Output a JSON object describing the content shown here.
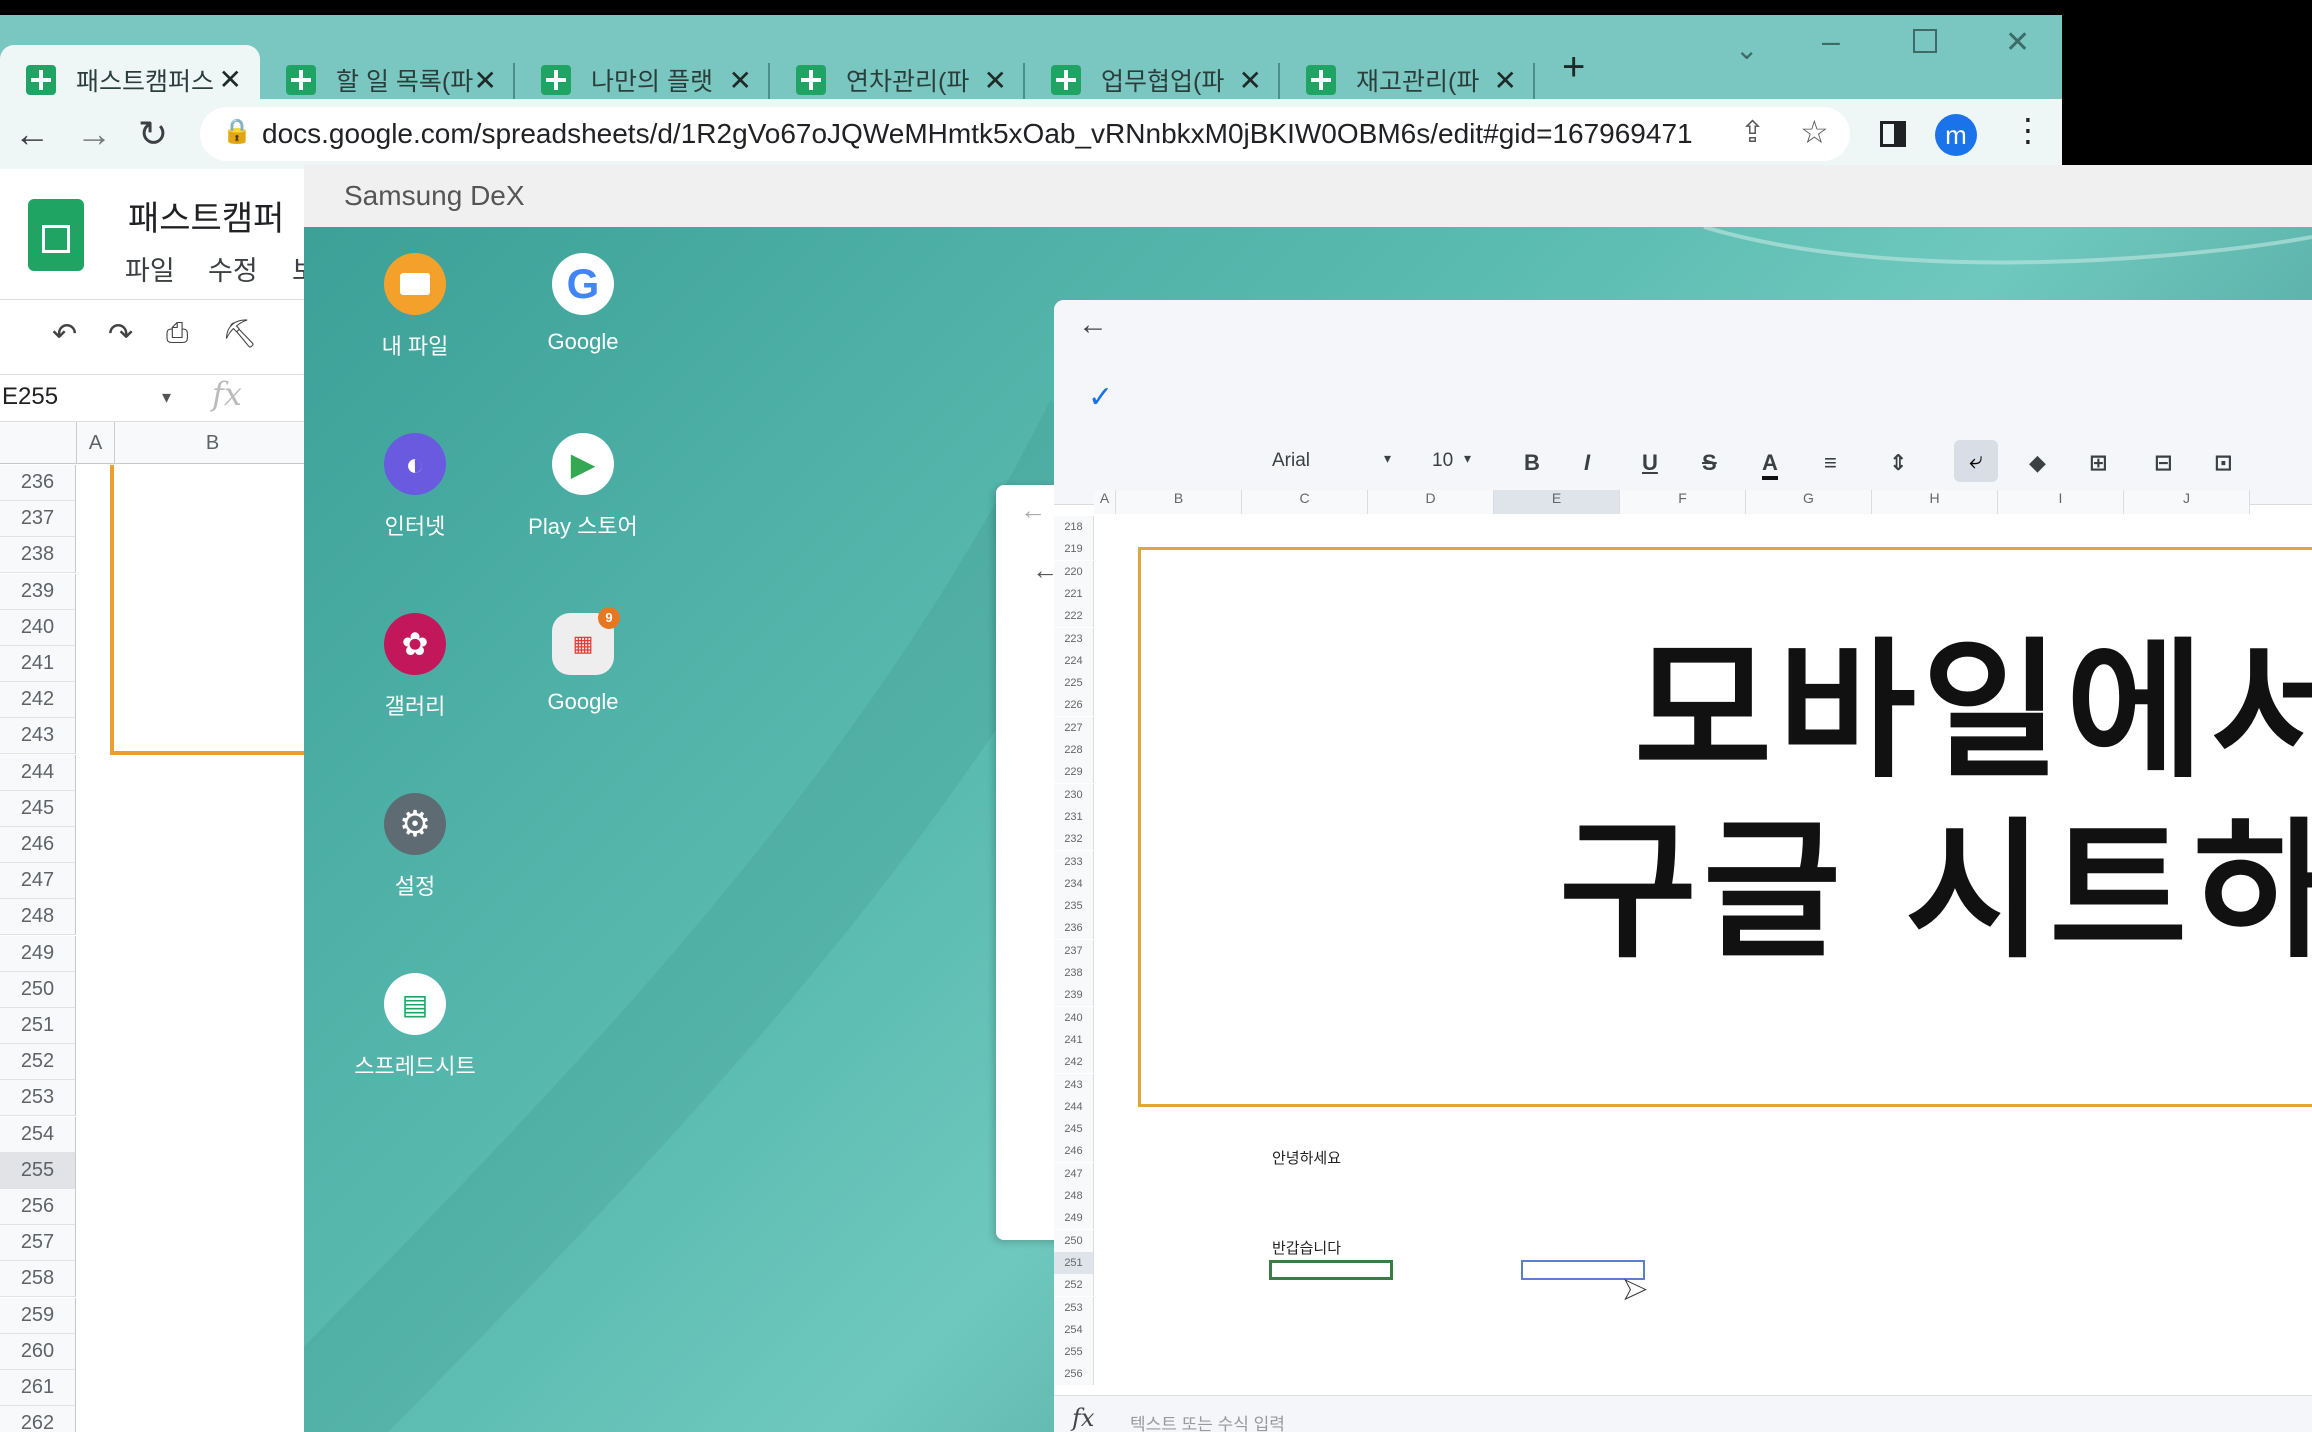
{
  "browser": {
    "tabs": [
      {
        "label": "패스트캠퍼스",
        "active": true
      },
      {
        "label": "할 일 목록(파"
      },
      {
        "label": "나만의 플랫"
      },
      {
        "label": "연차관리(파"
      },
      {
        "label": "업무협업(파"
      },
      {
        "label": "재고관리(파"
      }
    ],
    "url": "docs.google.com/spreadsheets/d/1R2gVo67oJQWeMHmtk5xOab_vRNnbkxM0jBKIW0OBM6s/edit#gid=167969471",
    "profile_initial": "m"
  },
  "sheets": {
    "doc_title": "패스트캠퍼",
    "menu": [
      "파일",
      "수정",
      "보"
    ],
    "name_box": "E255",
    "fx": "fx",
    "col_headers": [
      "A",
      "B"
    ],
    "rows": [
      "236",
      "237",
      "238",
      "239",
      "240",
      "241",
      "242",
      "243",
      "244",
      "245",
      "246",
      "247",
      "248",
      "249",
      "250",
      "251",
      "252",
      "253",
      "254",
      "255",
      "256",
      "257",
      "258",
      "259",
      "260",
      "261",
      "262"
    ],
    "selected_row": "255"
  },
  "dex": {
    "title": "Samsung DeX",
    "apps": [
      {
        "label": "내 파일",
        "icon": "folder-icon"
      },
      {
        "label": "Google",
        "icon": "google-icon"
      },
      {
        "label": "인터넷",
        "icon": "internet-icon"
      },
      {
        "label": "Play 스토어",
        "icon": "play-store-icon"
      },
      {
        "label": "갤러리",
        "icon": "gallery-icon"
      },
      {
        "label": "Google",
        "icon": "google-folder-icon",
        "badge": "9"
      },
      {
        "label": "설정",
        "icon": "settings-icon"
      },
      {
        "label": "스프레드시트",
        "icon": "sheets-icon"
      }
    ]
  },
  "mobile_sheet": {
    "font": "Arial",
    "size": "10",
    "cols": [
      "A",
      "B",
      "C",
      "D",
      "E",
      "F",
      "G",
      "H",
      "I",
      "J"
    ],
    "rows": [
      "218",
      "219",
      "220",
      "221",
      "222",
      "223",
      "224",
      "225",
      "226",
      "227",
      "228",
      "229",
      "230",
      "231",
      "232",
      "233",
      "234",
      "235",
      "236",
      "237",
      "238",
      "239",
      "240",
      "241",
      "242",
      "243",
      "244",
      "245",
      "246",
      "247",
      "248",
      "249",
      "250",
      "251",
      "252",
      "253",
      "254",
      "255",
      "256"
    ],
    "title_line1": "모바일에서",
    "title_line2": "구글 시트하",
    "cell_hello": "안녕하세요",
    "cell_nice": "반갑습니다",
    "formula_placeholder": "텍스트 또는 수식 입력"
  }
}
